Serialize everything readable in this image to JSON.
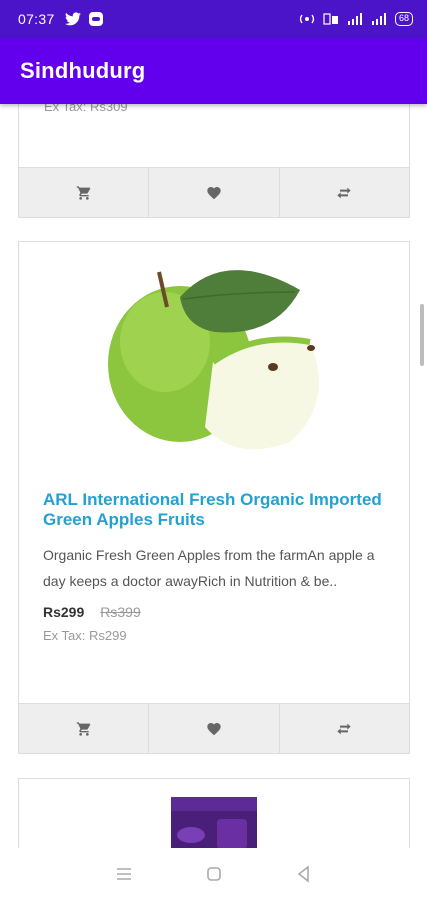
{
  "status_bar": {
    "time": "07:37",
    "battery": "68",
    "icons": [
      "twitter-icon",
      "message-icon",
      "hotspot-icon",
      "volte-icon",
      "signal-icon",
      "signal-icon",
      "battery-icon"
    ]
  },
  "app_bar": {
    "title": "Sindhudurg"
  },
  "previous_product": {
    "ex_tax": "Ex Tax: Rs309",
    "actions": [
      "cart-icon",
      "heart-icon",
      "compare-icon"
    ]
  },
  "product": {
    "title": "ARL International Fresh Organic Imported Green Apples Fruits",
    "description": "Organic Fresh Green Apples from the farmAn apple a day keeps a doctor awayRich in Nutrition & be..",
    "price_new": "Rs299",
    "price_old": "Rs399",
    "ex_tax": "Ex Tax: Rs299",
    "actions": [
      "cart-icon",
      "heart-icon",
      "compare-icon"
    ]
  },
  "next_product": {
    "image": "chocolate-image"
  },
  "colors": {
    "status_bar": "#4b14c8",
    "app_bar": "#6200ee",
    "title_link": "#23a1d1",
    "action_bg": "#eeeeee"
  },
  "nav_bar": {
    "icons": [
      "menu-icon",
      "home-icon",
      "back-icon"
    ]
  }
}
